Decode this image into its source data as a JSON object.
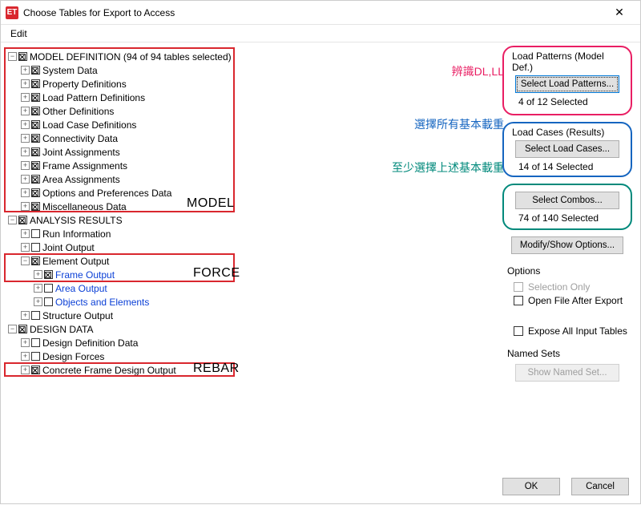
{
  "window": {
    "title": "Choose Tables for Export to Access"
  },
  "menu": {
    "edit": "Edit"
  },
  "tree": {
    "model_def": "MODEL DEFINITION  (94 of 94 tables selected)",
    "system_data": "System Data",
    "property_def": "Property Definitions",
    "load_pattern_def": "Load Pattern Definitions",
    "other_def": "Other Definitions",
    "load_case_def": "Load Case Definitions",
    "connectivity": "Connectivity Data",
    "joint_assign": "Joint Assignments",
    "frame_assign": "Frame Assignments",
    "area_assign": "Area Assignments",
    "options_pref": "Options and Preferences Data",
    "misc_data": "Miscellaneous Data",
    "analysis_results": "ANALYSIS RESULTS",
    "run_info": "Run Information",
    "joint_output": "Joint Output",
    "element_output": "Element Output",
    "frame_output": "Frame Output",
    "area_output": "Area Output",
    "objects_elements": "Objects and Elements",
    "structure_output": "Structure Output",
    "design_data": "DESIGN DATA",
    "design_def_data": "Design Definition Data",
    "design_forces": "Design Forces",
    "concrete_frame_design": "Concrete Frame Design Output"
  },
  "annotations": {
    "model": "MODEL",
    "force": "FORCE",
    "rebar": "REBAR",
    "note_red": "辨識DL,LL",
    "note_blue": "選擇所有基本載重",
    "note_green": "至少選擇上述基本載重"
  },
  "panels": {
    "load_patterns_title": "Load Patterns (Model Def.)",
    "select_load_patterns": "Select Load Patterns...",
    "load_patterns_status": "4 of 12 Selected",
    "load_cases_title": "Load Cases (Results)",
    "select_load_cases": "Select Load Cases...",
    "load_cases_status": "14 of 14 Selected",
    "select_combos": "Select Combos...",
    "combos_status": "74 of 140 Selected",
    "modify_show": "Modify/Show Options...",
    "options_title": "Options",
    "selection_only": "Selection Only",
    "open_file_after": "Open File After Export",
    "expose_all": "Expose All Input Tables",
    "named_sets_title": "Named Sets",
    "show_named_set": "Show Named Set..."
  },
  "buttons": {
    "ok": "OK",
    "cancel": "Cancel"
  }
}
